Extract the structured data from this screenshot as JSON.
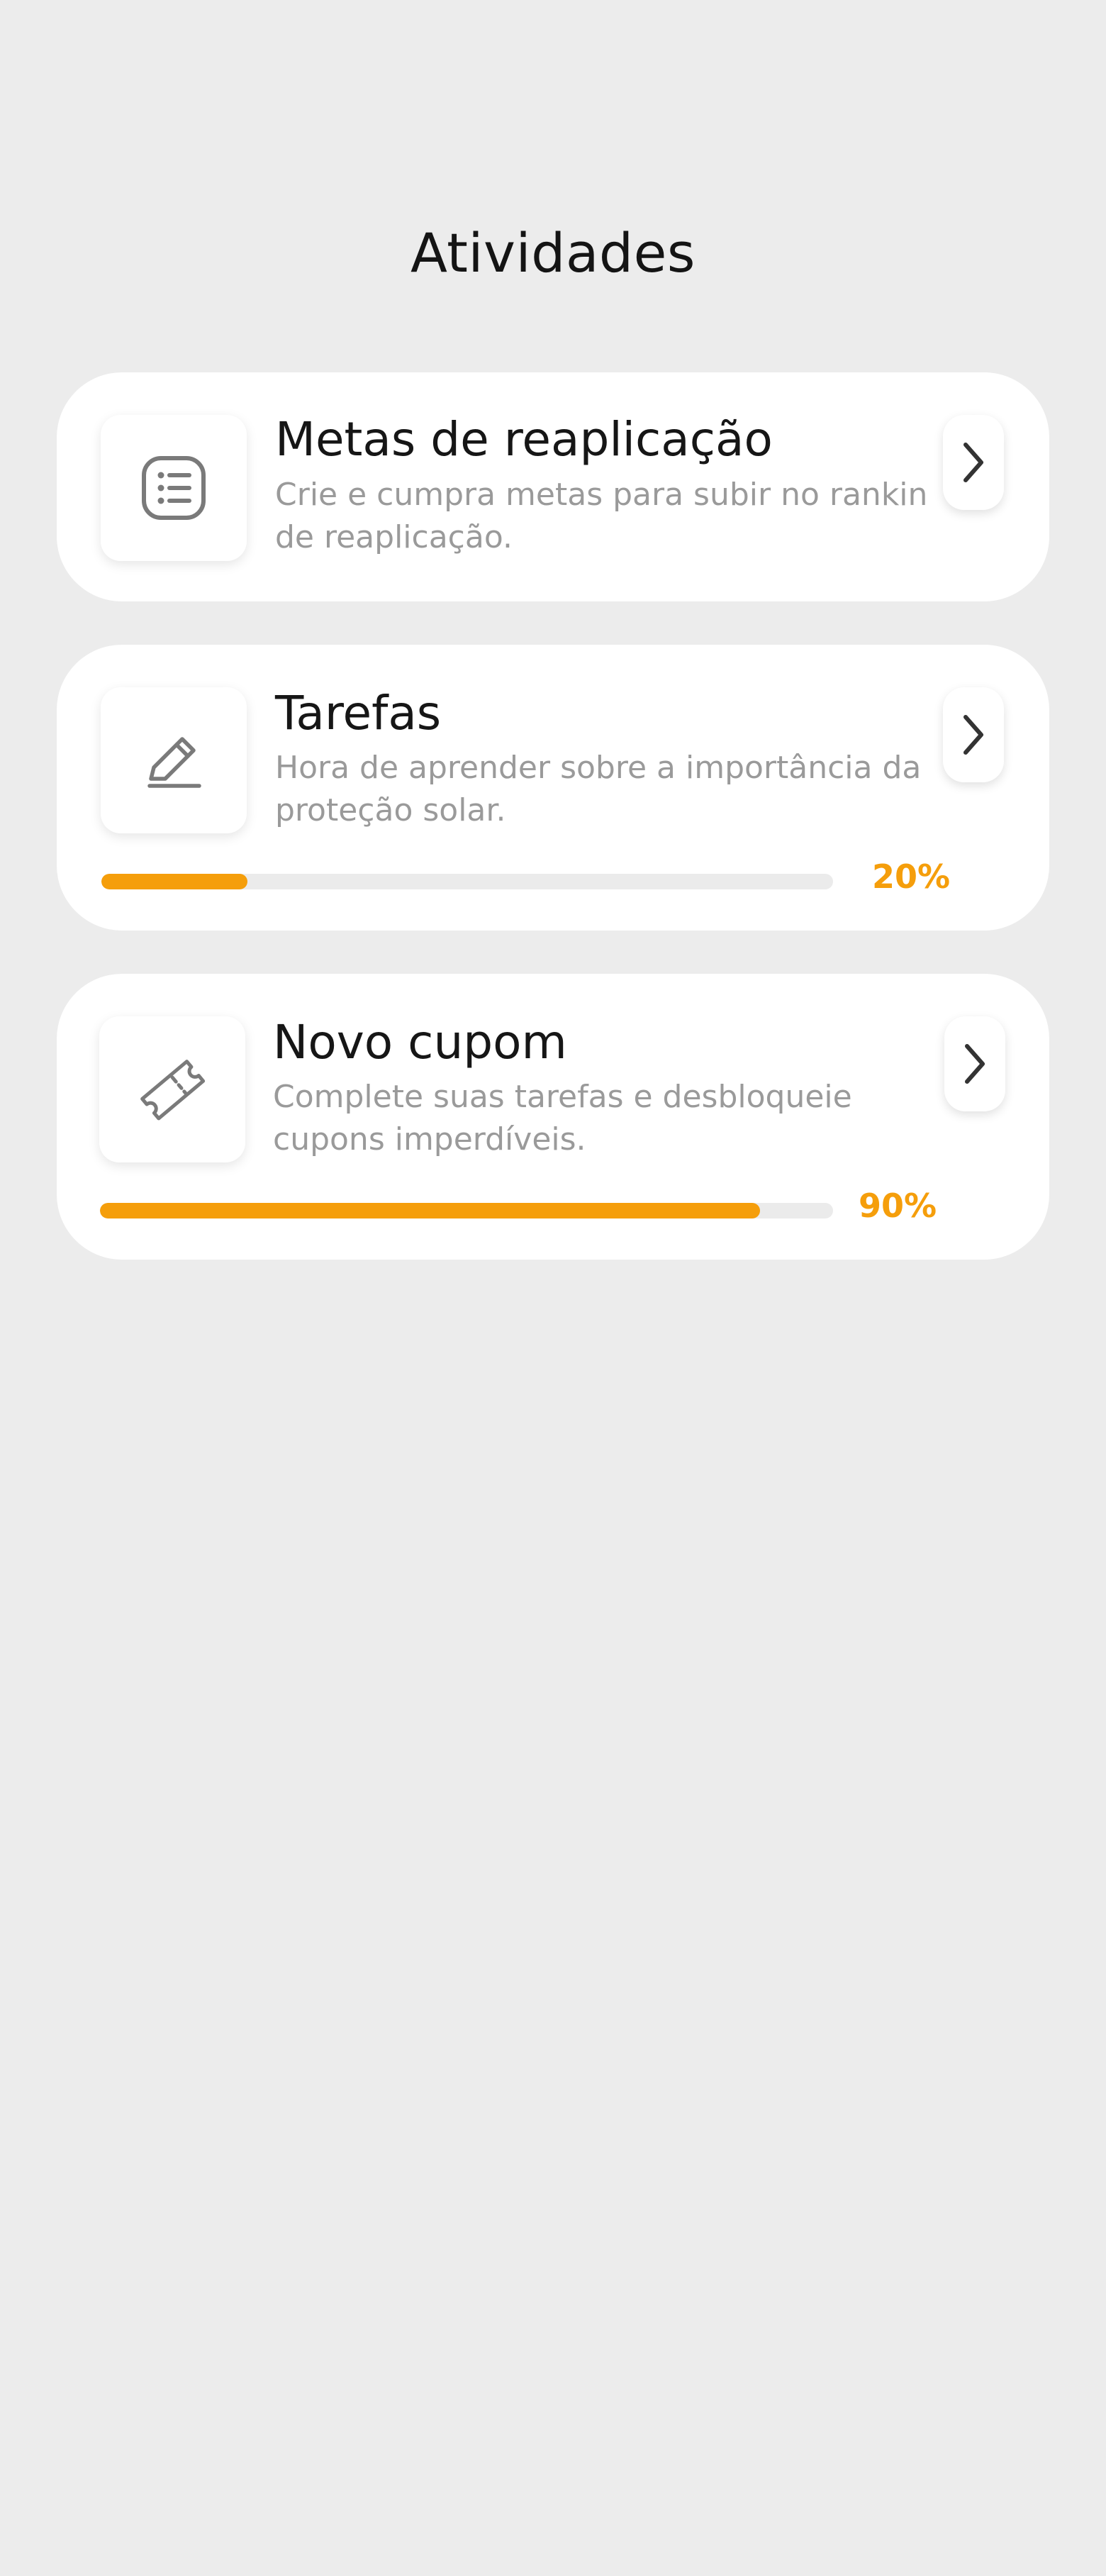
{
  "page": {
    "title": "Atividades"
  },
  "cards": [
    {
      "title": "Metas de reaplicação",
      "description": "Crie e cumpra metas para subir no rankin de reaplicação.",
      "icon": "list-icon"
    },
    {
      "title": "Tarefas",
      "description": "Hora de aprender sobre a importância da proteção solar.",
      "icon": "pencil-icon",
      "progress": 0.2,
      "progress_label": "20%"
    },
    {
      "title": "Novo cupom",
      "description": "Complete suas tarefas e desbloqueie cupons imperdíveis.",
      "icon": "ticket-icon",
      "progress": 0.9,
      "progress_label": "90%"
    }
  ],
  "colors": {
    "background": "#ececec",
    "card": "#ffffff",
    "accent": "#f59e0b",
    "title_text": "#161616",
    "secondary_text": "#9a9a9a",
    "icon": "#7a7a7a"
  }
}
